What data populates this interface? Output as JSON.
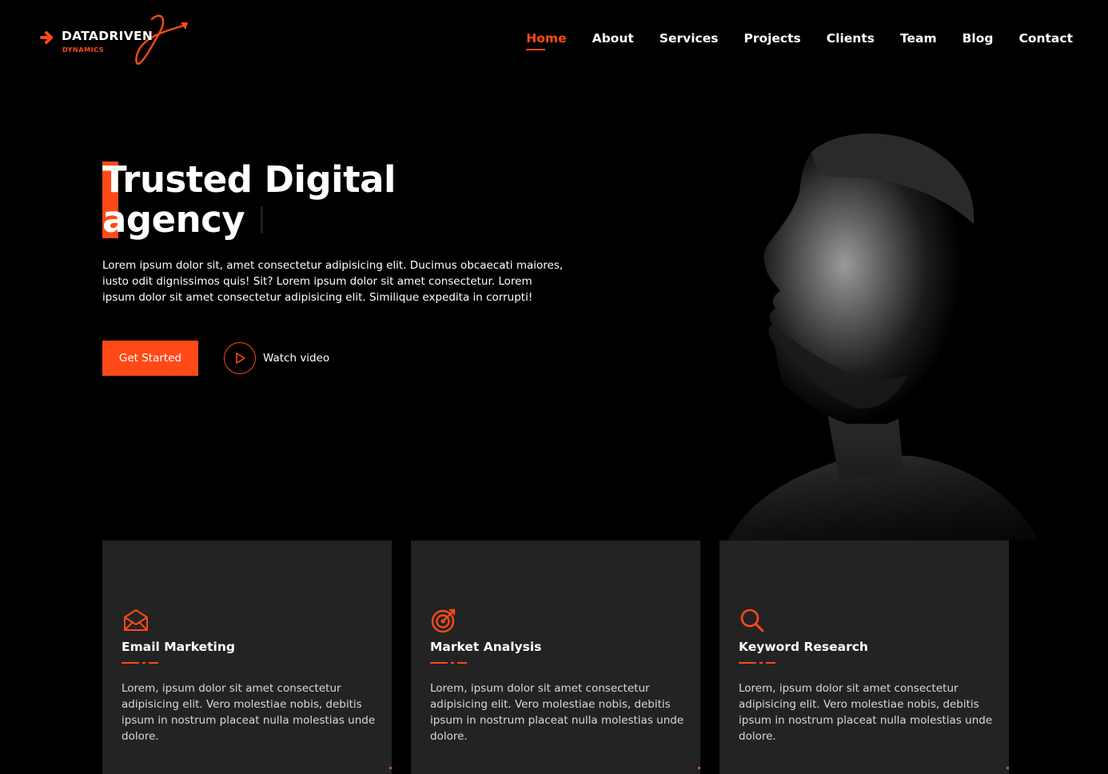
{
  "brand": {
    "name": "DATADRIVEN",
    "tagline": "DYNAMICS",
    "accent": "#ff4a17"
  },
  "nav": {
    "items": [
      {
        "label": "Home",
        "active": true
      },
      {
        "label": "About",
        "active": false
      },
      {
        "label": "Services",
        "active": false
      },
      {
        "label": "Projects",
        "active": false
      },
      {
        "label": "Clients",
        "active": false
      },
      {
        "label": "Team",
        "active": false
      },
      {
        "label": "Blog",
        "active": false
      },
      {
        "label": "Contact",
        "active": false
      }
    ]
  },
  "hero": {
    "title_line1": "Trusted Digital",
    "title_line2": "agency",
    "description": "Lorem ipsum dolor sit, amet consectetur adipisicing elit. Ducimus obcaecati maiores, iusto odit dignissimos quis! Sit? Lorem ipsum dolor sit amet consectetur. Lorem ipsum dolor sit amet consectetur adipisicing elit. Similique expedita in corrupti!",
    "cta_label": "Get Started",
    "watch_label": "Watch video"
  },
  "services": [
    {
      "icon": "envelope-icon",
      "title": "Email Marketing",
      "text": "Lorem, ipsum dolor sit amet consectetur adipisicing elit. Vero molestiae nobis, debitis ipsum in nostrum placeat nulla molestias unde dolore."
    },
    {
      "icon": "target-icon",
      "title": "Market Analysis",
      "text": "Lorem, ipsum dolor sit amet consectetur adipisicing elit. Vero molestiae nobis, debitis ipsum in nostrum placeat nulla molestias unde dolore."
    },
    {
      "icon": "search-icon",
      "title": "Keyword Research",
      "text": "Lorem, ipsum dolor sit amet consectetur adipisicing elit. Vero molestiae nobis, debitis ipsum in nostrum placeat nulla molestias unde dolore."
    }
  ]
}
